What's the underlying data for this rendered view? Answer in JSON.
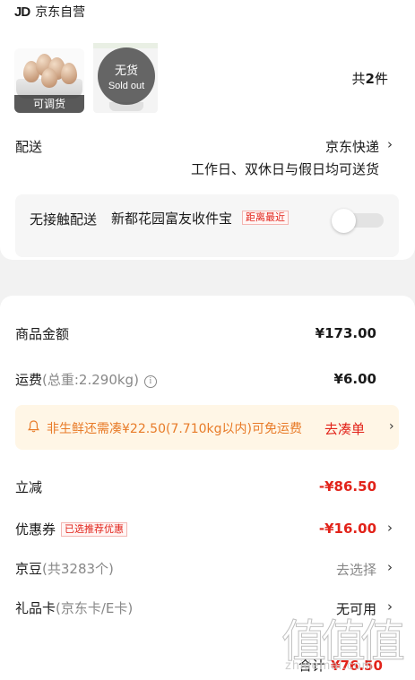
{
  "shop": {
    "logo": "JD",
    "name": "京东自营"
  },
  "products": [
    {
      "tag": "可调货",
      "image": "eggs-product-image"
    },
    {
      "status_cn": "无货",
      "status_en": "Sold out",
      "image": "white-appliance-product-image"
    }
  ],
  "item_count": {
    "prefix": "共",
    "count": "2",
    "suffix": "件"
  },
  "delivery": {
    "label": "配送",
    "method": "京东快递",
    "schedule": "工作日、双休日与假日均可送货"
  },
  "non_contact": {
    "title": "无接触配送",
    "address": "新都花园富友收件宝",
    "badge": "距离最近",
    "enabled": false
  },
  "summary": {
    "goods_label": "商品金额",
    "goods_value": "¥173.00",
    "shipping_label": "运费",
    "shipping_weight": "(总重:2.290kg)",
    "shipping_value": "¥6.00",
    "banner_text": "非生鲜还需凑¥22.50(7.710kg以内)可免运费",
    "banner_link": "去凑单",
    "discount_label": "立减",
    "discount_value": "-¥86.50",
    "coupon_label": "优惠券",
    "coupon_badge": "已选推荐优惠",
    "coupon_value": "-¥16.00",
    "beans_label": "京豆",
    "beans_count": "(共3283个)",
    "beans_value": "去选择",
    "giftcard_label": "礼品卡",
    "giftcard_type": "(京东卡/E卡)",
    "giftcard_value": "无可用"
  },
  "footer": {
    "total_label": "合计",
    "total_value": "¥76.50"
  },
  "watermark": {
    "glyphs": "值值值",
    "url": "zhidemai.com"
  },
  "colors": {
    "accent_red": "#e2231a",
    "banner_bg": "#fff6e6",
    "banner_text": "#e87b28"
  },
  "icons": {
    "chevron": "chevron-right-icon",
    "info": "info-icon",
    "bell": "bell-icon"
  }
}
